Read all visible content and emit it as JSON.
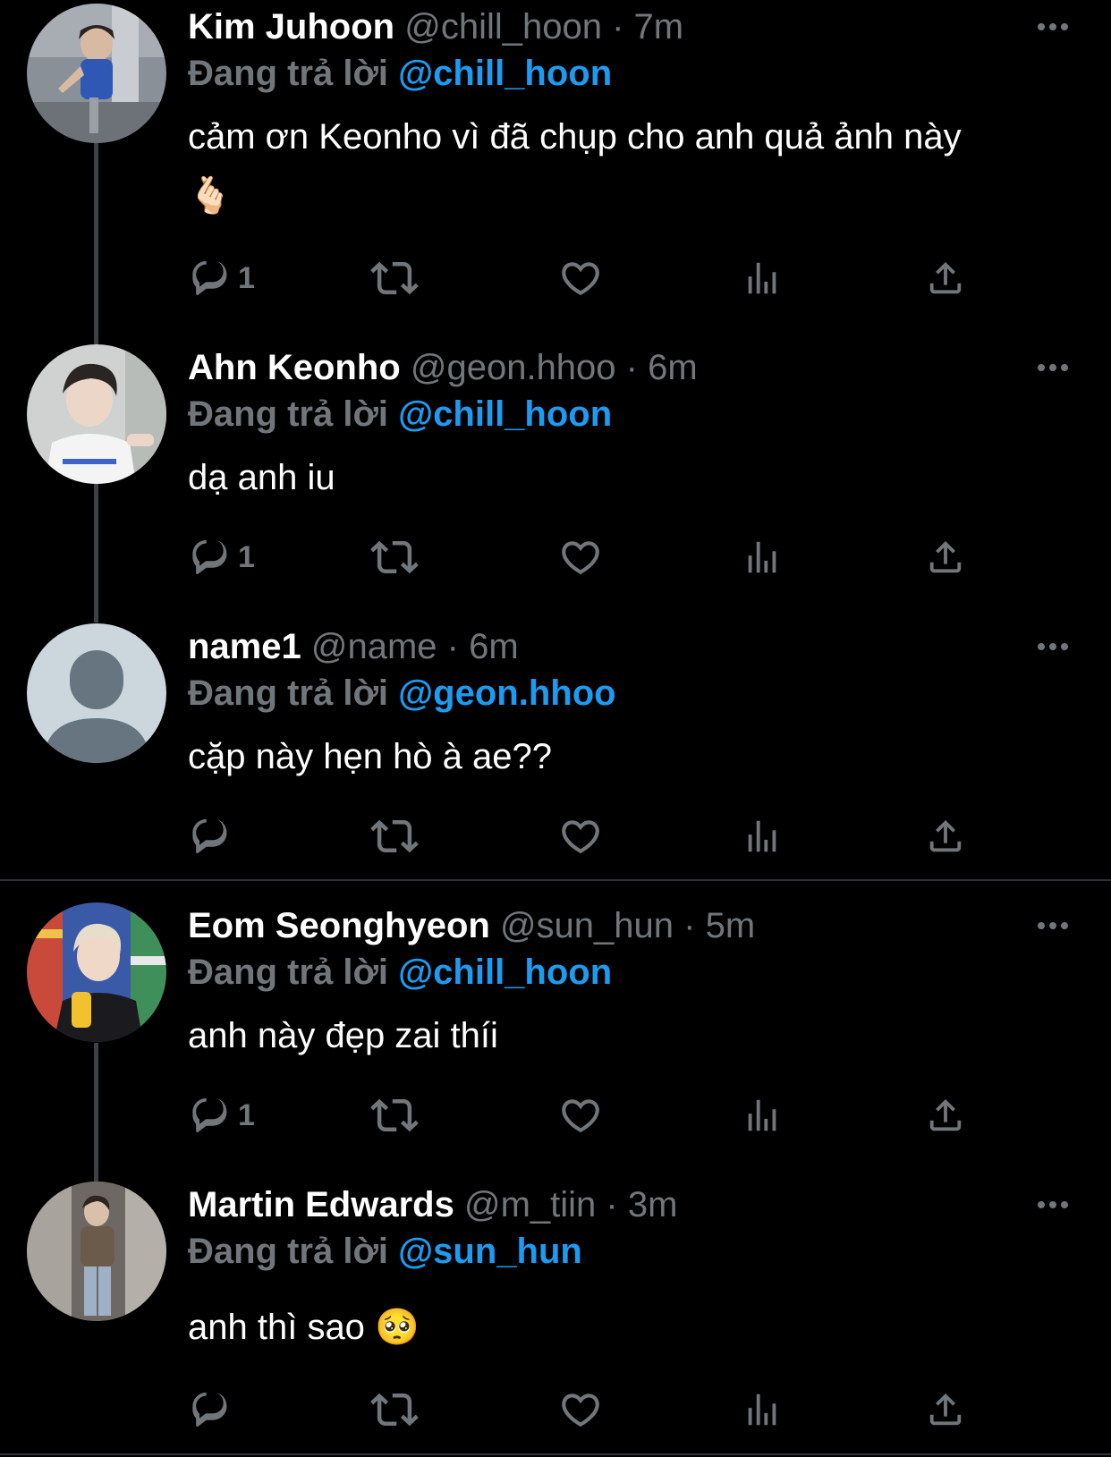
{
  "reply_label": "Đang trả lời",
  "tweets": [
    {
      "name": "Kim Juhoon",
      "handle": "@chill_hoon",
      "time": "7m",
      "reply_to": "@chill_hoon",
      "text_line1": "cảm ơn Keonho vì đã chụp cho anh quả ảnh này",
      "text_line2": "🫰🏻",
      "reply_count": "1"
    },
    {
      "name": "Ahn Keonho",
      "handle": "@geon.hhoo",
      "time": "6m",
      "reply_to": "@chill_hoon",
      "text_line1": "dạ anh iu",
      "reply_count": "1"
    },
    {
      "name": "name1",
      "handle": "@name",
      "time": "6m",
      "reply_to": "@geon.hhoo",
      "text_line1": "cặp này hẹn hò à ae??",
      "reply_count": ""
    },
    {
      "name": "Eom Seonghyeon",
      "handle": "@sun_hun",
      "time": "5m",
      "reply_to": "@chill_hoon",
      "text_line1": "anh này đẹp zai thíi",
      "reply_count": "1"
    },
    {
      "name": "Martin Edwards",
      "handle": "@m_tiin",
      "time": "3m",
      "reply_to": "@sun_hun",
      "text_line1": "anh thì sao 🥺",
      "reply_count": ""
    }
  ],
  "icons": {
    "reply": "reply-icon",
    "retweet": "retweet-icon",
    "like": "heart-icon",
    "views": "views-icon",
    "share": "share-icon",
    "more": "more-icon"
  },
  "colors": {
    "background": "#000000",
    "secondary_text": "#71767b",
    "mention": "#1d9bf0",
    "thread_line": "#3d4145"
  }
}
